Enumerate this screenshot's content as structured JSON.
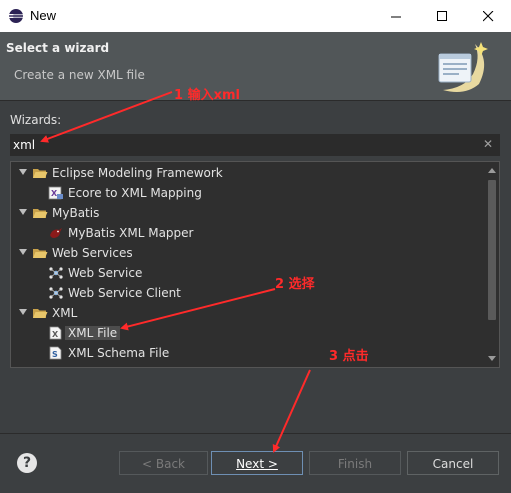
{
  "window": {
    "title": "New",
    "app_icon": "eclipse-icon",
    "controls": [
      "minimize-icon",
      "maximize-icon",
      "close-icon"
    ]
  },
  "header": {
    "heading": "Select a wizard",
    "description": "Create a new XML file",
    "graphic": "wizard-banner-icon"
  },
  "wizards": {
    "label": "Wizards:",
    "filter_value": "xml"
  },
  "tree": {
    "groups": [
      {
        "label": "Eclipse Modeling Framework",
        "items": [
          "Ecore to XML Mapping"
        ]
      },
      {
        "label": "MyBatis",
        "items": [
          "MyBatis XML Mapper"
        ]
      },
      {
        "label": "Web Services",
        "items": [
          "Web Service",
          "Web Service Client"
        ]
      },
      {
        "label": "XML",
        "items": [
          "XML File",
          "XML Schema File"
        ]
      }
    ],
    "selected": "XML File"
  },
  "buttons": {
    "help": "?",
    "back": "< Back",
    "next": "Next >",
    "finish": "Finish",
    "cancel": "Cancel"
  },
  "annotations": {
    "step1": "1 输入xml",
    "step2": "2 选择",
    "step3": "3 点击",
    "color": "#ff2a2a"
  },
  "colors": {
    "dialog_bg": "#3c3f41",
    "banner_bg": "#515658",
    "tree_bg": "#2f2f2f",
    "selection": "#4d4d4d"
  }
}
